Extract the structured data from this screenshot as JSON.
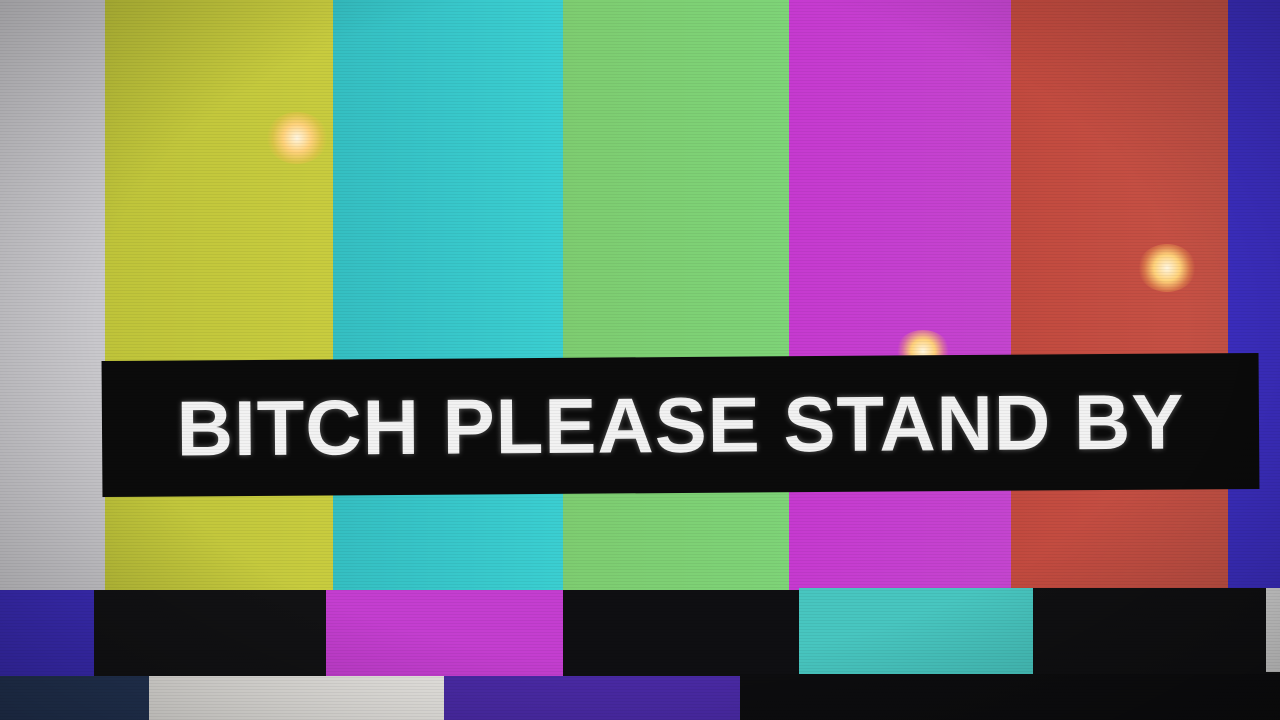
{
  "banner": {
    "text": "BITCH PLEASE STAND BY"
  },
  "colors": {
    "white_bar": "#c9c8cc",
    "yellow_bar": "#c7cc3d",
    "cyan_bar": "#37c7cc",
    "green_bar": "#79d174",
    "magenta_bar": "#c73fd2",
    "red_bar": "#c84c44",
    "blue_bar": "#3f2ec0",
    "black": "#0e0e10",
    "navy": "#233454",
    "white_tile": "#e8e6e2",
    "purple_tile": "#4a2aa6",
    "banner_bg": "#0b0b0b",
    "banner_text": "#f2f2f2"
  }
}
